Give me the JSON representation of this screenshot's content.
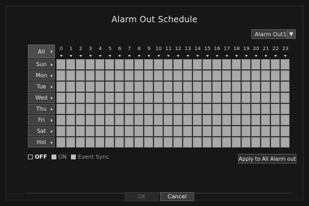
{
  "dialog": {
    "title": "Alarm Out Schedule",
    "alarm_select": {
      "value": "Alarm Out1",
      "arrow": "chevron-down-icon"
    }
  },
  "grid": {
    "all_label": "All",
    "hours": [
      "0",
      "1",
      "2",
      "3",
      "4",
      "5",
      "6",
      "7",
      "8",
      "9",
      "10",
      "11",
      "12",
      "13",
      "14",
      "15",
      "16",
      "17",
      "18",
      "19",
      "20",
      "21",
      "22",
      "23"
    ],
    "days": [
      "Sun",
      "Mon",
      "Tue",
      "Wed",
      "Thu",
      "Fri",
      "Sat",
      "Hol"
    ]
  },
  "legend": {
    "off": "OFF",
    "on": "ON",
    "event_sync": "Event Sync"
  },
  "buttons": {
    "apply_all": "Apply to All Alarm out",
    "ok": "OK",
    "cancel": "Cancel"
  },
  "colors": {
    "background": "#151515",
    "cell_event_sync": "#a9a9a9",
    "header_button": "#4c4c4c"
  }
}
